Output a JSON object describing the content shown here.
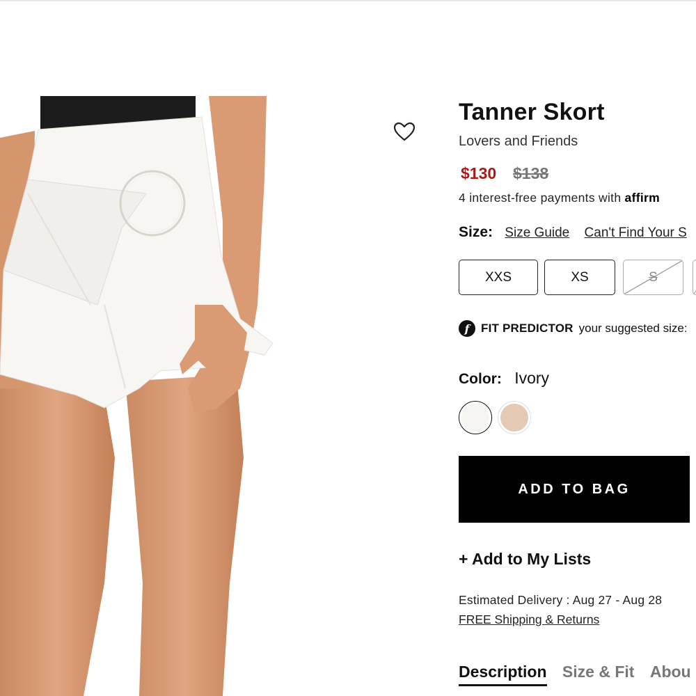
{
  "product": {
    "title": "Tanner Skort",
    "brand": "Lovers and Friends",
    "price_sale": "$130",
    "price_original": "$138",
    "affirm_text": "4 interest-free payments with ",
    "affirm_brand": "affirm"
  },
  "wishlist": {
    "icon": "heart-outline-icon"
  },
  "size": {
    "label": "Size:",
    "guide_link": "Size Guide",
    "cant_find_link": "Can't Find Your S",
    "options": [
      {
        "label": "XXS",
        "available": true
      },
      {
        "label": "XS",
        "available": true
      },
      {
        "label": "S",
        "available": false
      }
    ]
  },
  "fit_predictor": {
    "icon": "fit-predictor-icon",
    "label": "FIT PREDICTOR",
    "text": "your suggested size:"
  },
  "color": {
    "label": "Color:",
    "selected": "Ivory",
    "swatches": [
      {
        "name": "ivory",
        "hex": "#f7f5f2"
      },
      {
        "name": "blush",
        "hex": "#e4c9b5"
      }
    ]
  },
  "actions": {
    "add_to_bag": "ADD TO BAG",
    "add_to_lists": "+ Add to My Lists"
  },
  "delivery": {
    "estimate": "Estimated Delivery : Aug 27 - Aug 28",
    "shipping_link": "FREE Shipping & Returns"
  },
  "tabs": [
    {
      "label": "Description",
      "active": true
    },
    {
      "label": "Size & Fit",
      "active": false
    },
    {
      "label": "Abou",
      "active": false
    }
  ]
}
